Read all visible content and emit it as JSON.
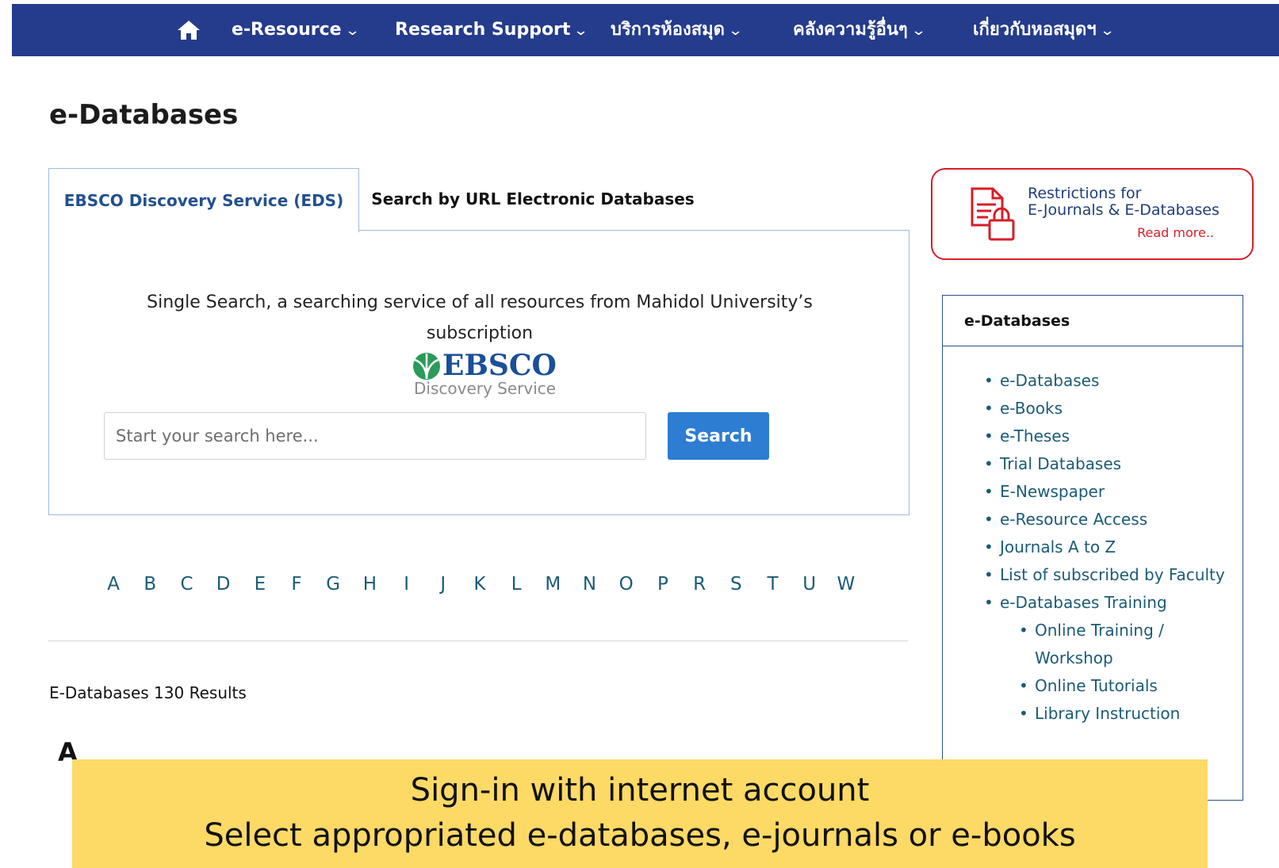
{
  "nav": {
    "home_icon": "home-icon",
    "items": [
      {
        "label": "e-Resource"
      },
      {
        "label": "Research Support"
      },
      {
        "label": "บริการห้องสมุด"
      },
      {
        "label": "คลังความรู้อื่นๆ"
      },
      {
        "label": "เกี่ยวกับหอสมุดฯ"
      }
    ],
    "background": "#253c8c"
  },
  "page": {
    "title": "e-Databases"
  },
  "tabs": [
    {
      "label": "EBSCO Discovery Service (EDS)",
      "active": true
    },
    {
      "label": "Search by URL Electronic Databases",
      "active": false
    }
  ],
  "eds": {
    "description": "Single Search, a searching service of all resources from Mahidol University’s subscription",
    "logo_name": "EBSCO",
    "logo_sub": "Discovery Service",
    "search_placeholder": "Start your search here...",
    "search_button": "Search"
  },
  "alphabet": [
    "A",
    "B",
    "C",
    "D",
    "E",
    "F",
    "G",
    "H",
    "I",
    "J",
    "K",
    "L",
    "M",
    "N",
    "O",
    "P",
    "R",
    "S",
    "T",
    "U",
    "W"
  ],
  "results": {
    "count_text": "E-Databases 130 Results",
    "first_section": "A"
  },
  "restrictions": {
    "title_line1": "Restrictions for",
    "title_line2": "E-Journals & E-Databases",
    "read_more": "Read more..",
    "accent": "#d71e27"
  },
  "sidebar": {
    "heading": "e-Databases",
    "items": [
      {
        "label": "e-Databases"
      },
      {
        "label": "e-Books"
      },
      {
        "label": "e-Theses"
      },
      {
        "label": "Trial Databases"
      },
      {
        "label": "E-Newspaper"
      },
      {
        "label": "e-Resource Access"
      },
      {
        "label": "Journals A to Z"
      },
      {
        "label": "List of subscribed by Faculty"
      },
      {
        "label": "e-Databases Training"
      }
    ],
    "subitems": [
      {
        "label": "Online Training / Workshop"
      },
      {
        "label": "Online Tutorials"
      },
      {
        "label": "Library Instruction"
      }
    ]
  },
  "callout": {
    "line1": "Sign-in with internet account",
    "line2": "Select appropriated e-databases, e-journals or e-books",
    "background": "#fdd966"
  }
}
